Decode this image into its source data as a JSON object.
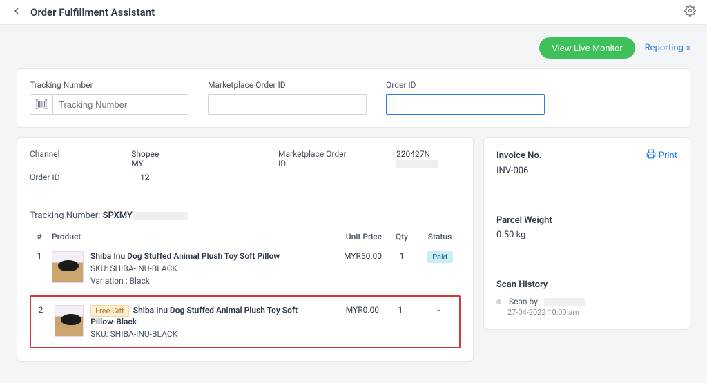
{
  "header": {
    "title": "Order Fulfillment Assistant"
  },
  "actions": {
    "live_monitor": "View Live Monitor",
    "reporting": "Reporting"
  },
  "search": {
    "tracking_label": "Tracking Number",
    "marketplace_label": "Marketplace Order ID",
    "order_label": "Order ID",
    "tracking_placeholder": "Tracking Number",
    "marketplace_placeholder": "",
    "order_placeholder": ""
  },
  "order": {
    "channel_label": "Channel",
    "channel_value": "Shopee MY",
    "marketplace_id_label": "Marketplace Order ID",
    "marketplace_id_value": "220427N",
    "order_id_label": "Order ID",
    "order_id_value": "12",
    "tracking_label": "Tracking Number:",
    "tracking_value": "SPXMY"
  },
  "columns": {
    "num": "#",
    "product": "Product",
    "unit_price": "Unit Price",
    "qty": "Qty",
    "status": "Status"
  },
  "items": [
    {
      "num": "1",
      "name": "Shiba Inu Dog Stuffed Animal Plush Toy Soft Pillow",
      "sku_label": "SKU: SHIBA-INU-BLACK",
      "variation_label": "Variation : Black",
      "unit_price": "MYR50.00",
      "qty": "1",
      "status": "Paid",
      "free_gift": false
    },
    {
      "num": "2",
      "free_gift_label": "Free Gift",
      "name": "Shiba Inu Dog Stuffed Animal Plush Toy Soft Pillow-Black",
      "sku_label": "SKU: SHIBA-INU-BLACK",
      "variation_label": "",
      "unit_price": "MYR0.00",
      "qty": "1",
      "status": "-",
      "free_gift": true
    }
  ],
  "right": {
    "invoice_label": "Invoice No.",
    "invoice_value": "INV-006",
    "print": "Print",
    "parcel_label": "Parcel Weight",
    "parcel_value": "0.50 kg",
    "scan_label": "Scan History",
    "scan_by_label": "Scan by :",
    "scan_time": "27-04-2022 10:00 am"
  }
}
